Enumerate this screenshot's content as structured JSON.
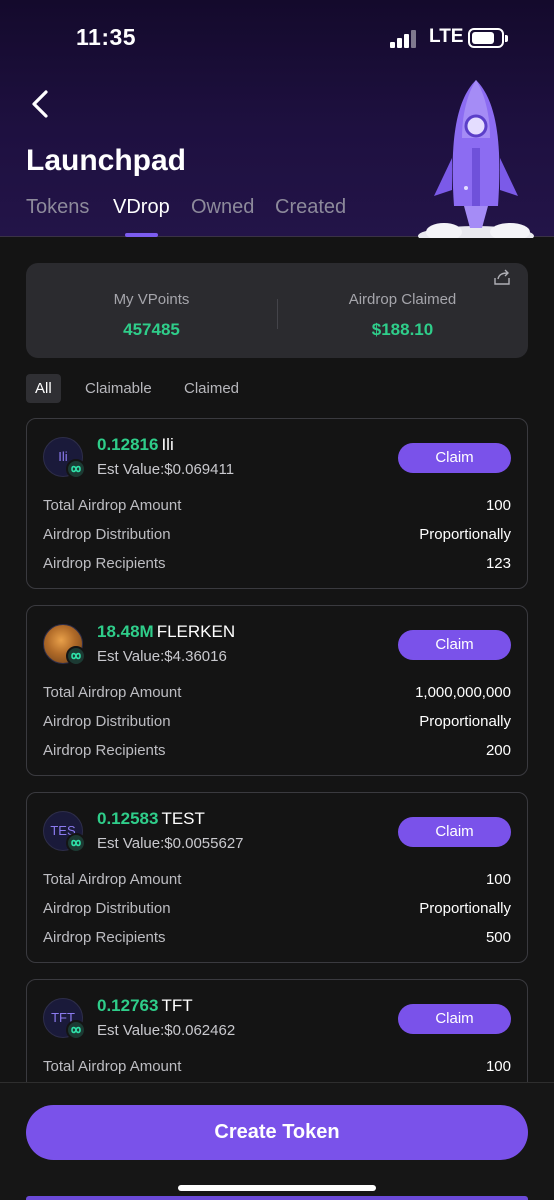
{
  "status_bar": {
    "time": "11:35",
    "network": "LTE"
  },
  "header": {
    "title": "Launchpad",
    "tabs": [
      {
        "label": "Tokens"
      },
      {
        "label": "VDrop"
      },
      {
        "label": "Owned"
      },
      {
        "label": "Created"
      }
    ],
    "active_tab": "VDrop"
  },
  "stats": {
    "my_vpoints_label": "My VPoints",
    "my_vpoints_value": "457485",
    "airdrop_claimed_label": "Airdrop Claimed",
    "airdrop_claimed_value": "$188.10"
  },
  "filters": [
    {
      "label": "All"
    },
    {
      "label": "Claimable"
    },
    {
      "label": "Claimed"
    }
  ],
  "active_filter": "All",
  "row_labels": {
    "total": "Total Airdrop Amount",
    "distribution": "Airdrop Distribution",
    "recipients": "Airdrop Recipients"
  },
  "cards": [
    {
      "avatar_text": "Ili",
      "amount": "0.12816",
      "symbol": "Ili",
      "est_value": "Est Value:$0.069411",
      "claim_label": "Claim",
      "total": "100",
      "distribution": "Proportionally",
      "recipients": "123"
    },
    {
      "avatar_text": "",
      "amount": "18.48M",
      "symbol": "FLERKEN",
      "est_value": "Est Value:$4.36016",
      "claim_label": "Claim",
      "total": "1,000,000,000",
      "distribution": "Proportionally",
      "recipients": "200"
    },
    {
      "avatar_text": "TES",
      "amount": "0.12583",
      "symbol": "TEST",
      "est_value": "Est Value:$0.0055627",
      "claim_label": "Claim",
      "total": "100",
      "distribution": "Proportionally",
      "recipients": "500"
    },
    {
      "avatar_text": "TFT",
      "amount": "0.12763",
      "symbol": "TFT",
      "est_value": "Est Value:$0.062462",
      "claim_label": "Claim",
      "total": "100"
    }
  ],
  "bottom": {
    "create_label": "Create Token"
  },
  "icons": {
    "back": "chevron-left-icon",
    "share": "share-icon",
    "chain_badge": "infinity-badge-icon",
    "illustration": "rocket-illustration"
  },
  "colors": {
    "accent": "#7a52ea",
    "positive": "#2fcd8a",
    "header_bg": "#1e1040"
  }
}
